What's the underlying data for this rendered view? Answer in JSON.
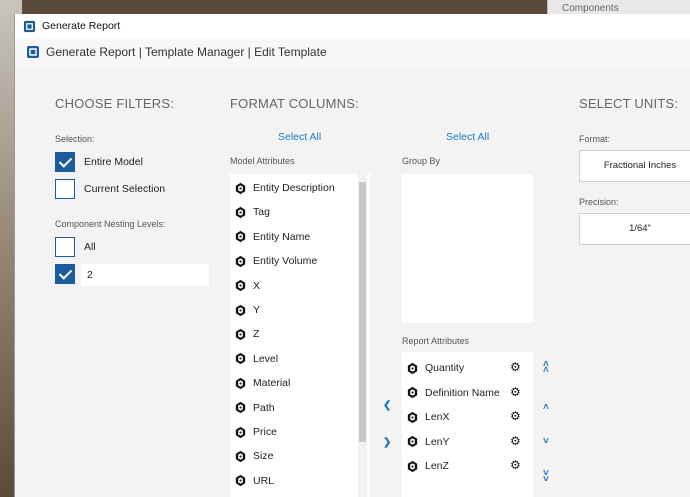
{
  "background": {
    "panel_label": "Components"
  },
  "window": {
    "title": "Generate Report"
  },
  "appbar": {
    "breadcrumb": "Generate Report | Template Manager | Edit Template"
  },
  "filters": {
    "heading": "CHOOSE FILTERS:",
    "selection_label": "Selection:",
    "entire_model": "Entire Model",
    "entire_model_checked": true,
    "current_selection": "Current Selection",
    "current_selection_checked": false,
    "nesting_label": "Component Nesting Levels:",
    "all_label": "All",
    "all_checked": false,
    "level_checked": true,
    "level_value": "2"
  },
  "columns": {
    "heading": "FORMAT COLUMNS:",
    "select_all_left": "Select All",
    "select_all_right": "Select All",
    "model_attributes_label": "Model Attributes",
    "model_attributes": [
      "Entity Description",
      "Tag",
      "Entity Name",
      "Entity Volume",
      "X",
      "Y",
      "Z",
      "Level",
      "Material",
      "Path",
      "Price",
      "Size",
      "URL"
    ],
    "group_by_label": "Group By",
    "report_attributes_label": "Report Attributes",
    "report_attributes": [
      "Quantity",
      "Definition Name",
      "LenX",
      "LenY",
      "LenZ"
    ]
  },
  "units": {
    "heading": "SELECT UNITS:",
    "format_label": "Format:",
    "format_value": "Fractional Inches",
    "precision_label": "Precision:",
    "precision_value": "1/64\""
  },
  "colors": {
    "accent": "#1b5c9c",
    "link": "#1a7ac8"
  }
}
